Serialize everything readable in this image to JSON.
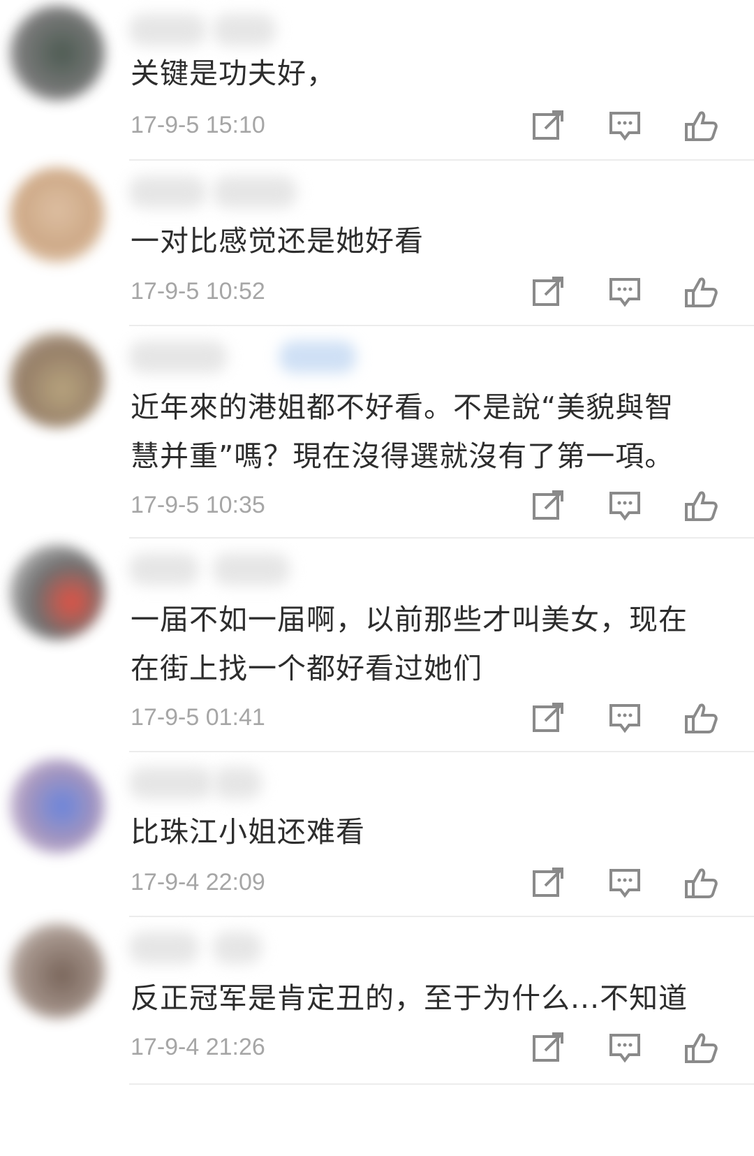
{
  "comments": [
    {
      "text_lines": [
        "关键是功夫好，"
      ],
      "time": "17-9-5 15:10"
    },
    {
      "text_lines": [
        "一对比感觉还是她好看"
      ],
      "time": "17-9-5 10:52"
    },
    {
      "text_lines": [
        "近年來的港姐都不好看。不是說“美貌與智",
        "慧并重”嗎？現在沒得選就沒有了第一項。"
      ],
      "time": "17-9-5 10:35"
    },
    {
      "text_lines": [
        "一届不如一届啊，以前那些才叫美女，现在",
        "在街上找一个都好看过她们"
      ],
      "time": "17-9-5 01:41"
    },
    {
      "text_lines": [
        "比珠江小姐还难看"
      ],
      "time": "17-9-4 22:09"
    },
    {
      "text_lines": [
        "反正冠军是肯定丑的，至于为什么...不知道"
      ],
      "time": "17-9-4 21:26"
    }
  ],
  "icons": {
    "share": "share-edit-icon",
    "reply": "reply-comment-icon",
    "like": "thumbs-up-icon"
  },
  "colors": {
    "text": "#2d2d2d",
    "time": "#a6a6a6",
    "icon": "#8a8a8a",
    "divider": "#ececec"
  }
}
